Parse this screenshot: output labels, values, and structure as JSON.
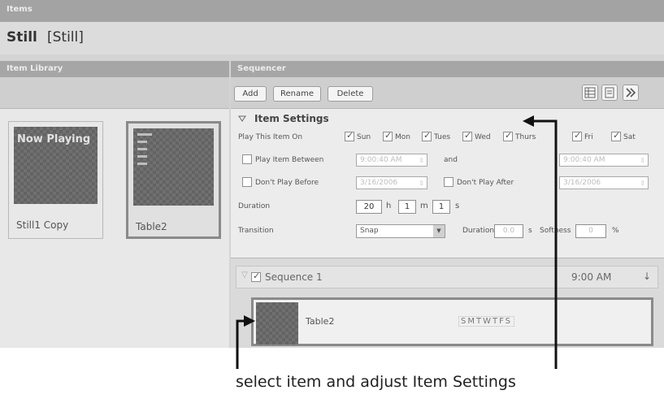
{
  "window": {
    "title": "Items"
  },
  "item": {
    "name": "Still",
    "alias": "[Still]"
  },
  "library": {
    "header": "Item Library",
    "items": [
      {
        "thumb_text": "Now Playing",
        "caption": "Still1 Copy",
        "selected": false
      },
      {
        "thumb_text": "",
        "caption": "Table2",
        "selected": true
      }
    ]
  },
  "sequencer": {
    "header": "Sequencer",
    "buttons": {
      "add": "Add",
      "rename": "Rename",
      "delete": "Delete"
    },
    "tool_icons": [
      "list-view-icon",
      "calendar-view-icon",
      "expand-icon"
    ]
  },
  "settings": {
    "title": "Item Settings",
    "play_on_label": "Play This Item On",
    "days": [
      {
        "label": "Sun",
        "checked": true
      },
      {
        "label": "Mon",
        "checked": true
      },
      {
        "label": "Tues",
        "checked": true
      },
      {
        "label": "Wed",
        "checked": true
      },
      {
        "label": "Thurs",
        "checked": true
      },
      {
        "label": "Fri",
        "checked": true
      },
      {
        "label": "Sat",
        "checked": true
      }
    ],
    "play_between_label": "Play Item Between",
    "play_between_start": "9:00:40 AM",
    "and_label": "and",
    "play_between_end": "9:00:40 AM",
    "dont_play_before_label": "Don't Play Before",
    "dont_play_before_value": "3/16/2006",
    "dont_play_after_label": "Don't Play After",
    "dont_play_after_value": "3/16/2006",
    "duration_label": "Duration",
    "duration_h": "20",
    "h_unit": "h",
    "duration_m": "1",
    "m_unit": "m",
    "duration_s": "1",
    "s_unit": "s",
    "transition_label": "Transition",
    "transition_value": "Snap",
    "transition_duration_label": "Duration",
    "transition_duration_value": "0.0",
    "transition_duration_unit": "s",
    "softness_label": "Softness",
    "softness_value": "0",
    "softness_unit": "%"
  },
  "sequence": {
    "name": "Sequence 1",
    "checked": true,
    "time": "9:00 AM",
    "item_name": "Table2",
    "day_flags": "SMTWTFS"
  },
  "caption": "select item and adjust Item Settings"
}
